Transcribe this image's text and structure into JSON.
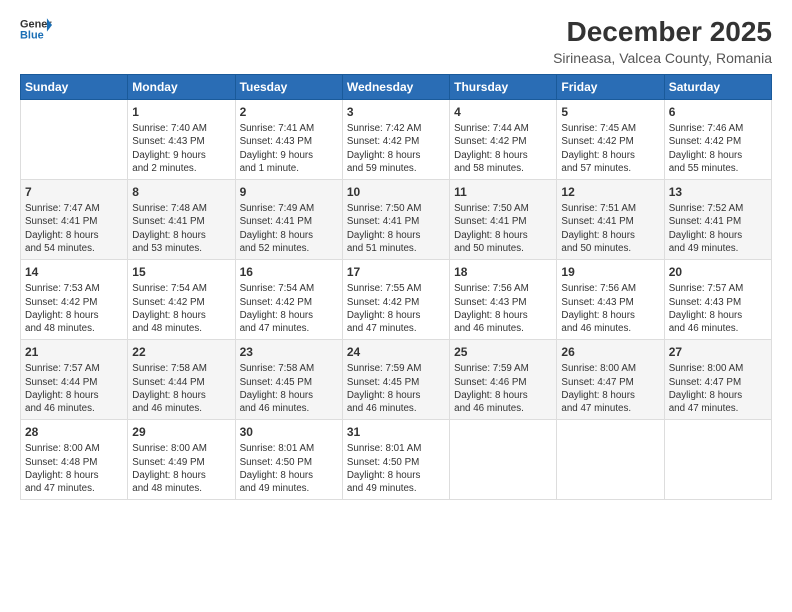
{
  "header": {
    "logo_line1": "General",
    "logo_line2": "Blue",
    "title": "December 2025",
    "subtitle": "Sirineasa, Valcea County, Romania"
  },
  "days_of_week": [
    "Sunday",
    "Monday",
    "Tuesday",
    "Wednesday",
    "Thursday",
    "Friday",
    "Saturday"
  ],
  "weeks": [
    [
      {
        "day": "",
        "info": ""
      },
      {
        "day": "1",
        "info": "Sunrise: 7:40 AM\nSunset: 4:43 PM\nDaylight: 9 hours\nand 2 minutes."
      },
      {
        "day": "2",
        "info": "Sunrise: 7:41 AM\nSunset: 4:43 PM\nDaylight: 9 hours\nand 1 minute."
      },
      {
        "day": "3",
        "info": "Sunrise: 7:42 AM\nSunset: 4:42 PM\nDaylight: 8 hours\nand 59 minutes."
      },
      {
        "day": "4",
        "info": "Sunrise: 7:44 AM\nSunset: 4:42 PM\nDaylight: 8 hours\nand 58 minutes."
      },
      {
        "day": "5",
        "info": "Sunrise: 7:45 AM\nSunset: 4:42 PM\nDaylight: 8 hours\nand 57 minutes."
      },
      {
        "day": "6",
        "info": "Sunrise: 7:46 AM\nSunset: 4:42 PM\nDaylight: 8 hours\nand 55 minutes."
      }
    ],
    [
      {
        "day": "7",
        "info": "Sunrise: 7:47 AM\nSunset: 4:41 PM\nDaylight: 8 hours\nand 54 minutes."
      },
      {
        "day": "8",
        "info": "Sunrise: 7:48 AM\nSunset: 4:41 PM\nDaylight: 8 hours\nand 53 minutes."
      },
      {
        "day": "9",
        "info": "Sunrise: 7:49 AM\nSunset: 4:41 PM\nDaylight: 8 hours\nand 52 minutes."
      },
      {
        "day": "10",
        "info": "Sunrise: 7:50 AM\nSunset: 4:41 PM\nDaylight: 8 hours\nand 51 minutes."
      },
      {
        "day": "11",
        "info": "Sunrise: 7:50 AM\nSunset: 4:41 PM\nDaylight: 8 hours\nand 50 minutes."
      },
      {
        "day": "12",
        "info": "Sunrise: 7:51 AM\nSunset: 4:41 PM\nDaylight: 8 hours\nand 50 minutes."
      },
      {
        "day": "13",
        "info": "Sunrise: 7:52 AM\nSunset: 4:41 PM\nDaylight: 8 hours\nand 49 minutes."
      }
    ],
    [
      {
        "day": "14",
        "info": "Sunrise: 7:53 AM\nSunset: 4:42 PM\nDaylight: 8 hours\nand 48 minutes."
      },
      {
        "day": "15",
        "info": "Sunrise: 7:54 AM\nSunset: 4:42 PM\nDaylight: 8 hours\nand 48 minutes."
      },
      {
        "day": "16",
        "info": "Sunrise: 7:54 AM\nSunset: 4:42 PM\nDaylight: 8 hours\nand 47 minutes."
      },
      {
        "day": "17",
        "info": "Sunrise: 7:55 AM\nSunset: 4:42 PM\nDaylight: 8 hours\nand 47 minutes."
      },
      {
        "day": "18",
        "info": "Sunrise: 7:56 AM\nSunset: 4:43 PM\nDaylight: 8 hours\nand 46 minutes."
      },
      {
        "day": "19",
        "info": "Sunrise: 7:56 AM\nSunset: 4:43 PM\nDaylight: 8 hours\nand 46 minutes."
      },
      {
        "day": "20",
        "info": "Sunrise: 7:57 AM\nSunset: 4:43 PM\nDaylight: 8 hours\nand 46 minutes."
      }
    ],
    [
      {
        "day": "21",
        "info": "Sunrise: 7:57 AM\nSunset: 4:44 PM\nDaylight: 8 hours\nand 46 minutes."
      },
      {
        "day": "22",
        "info": "Sunrise: 7:58 AM\nSunset: 4:44 PM\nDaylight: 8 hours\nand 46 minutes."
      },
      {
        "day": "23",
        "info": "Sunrise: 7:58 AM\nSunset: 4:45 PM\nDaylight: 8 hours\nand 46 minutes."
      },
      {
        "day": "24",
        "info": "Sunrise: 7:59 AM\nSunset: 4:45 PM\nDaylight: 8 hours\nand 46 minutes."
      },
      {
        "day": "25",
        "info": "Sunrise: 7:59 AM\nSunset: 4:46 PM\nDaylight: 8 hours\nand 46 minutes."
      },
      {
        "day": "26",
        "info": "Sunrise: 8:00 AM\nSunset: 4:47 PM\nDaylight: 8 hours\nand 47 minutes."
      },
      {
        "day": "27",
        "info": "Sunrise: 8:00 AM\nSunset: 4:47 PM\nDaylight: 8 hours\nand 47 minutes."
      }
    ],
    [
      {
        "day": "28",
        "info": "Sunrise: 8:00 AM\nSunset: 4:48 PM\nDaylight: 8 hours\nand 47 minutes."
      },
      {
        "day": "29",
        "info": "Sunrise: 8:00 AM\nSunset: 4:49 PM\nDaylight: 8 hours\nand 48 minutes."
      },
      {
        "day": "30",
        "info": "Sunrise: 8:01 AM\nSunset: 4:50 PM\nDaylight: 8 hours\nand 49 minutes."
      },
      {
        "day": "31",
        "info": "Sunrise: 8:01 AM\nSunset: 4:50 PM\nDaylight: 8 hours\nand 49 minutes."
      },
      {
        "day": "",
        "info": ""
      },
      {
        "day": "",
        "info": ""
      },
      {
        "day": "",
        "info": ""
      }
    ]
  ]
}
